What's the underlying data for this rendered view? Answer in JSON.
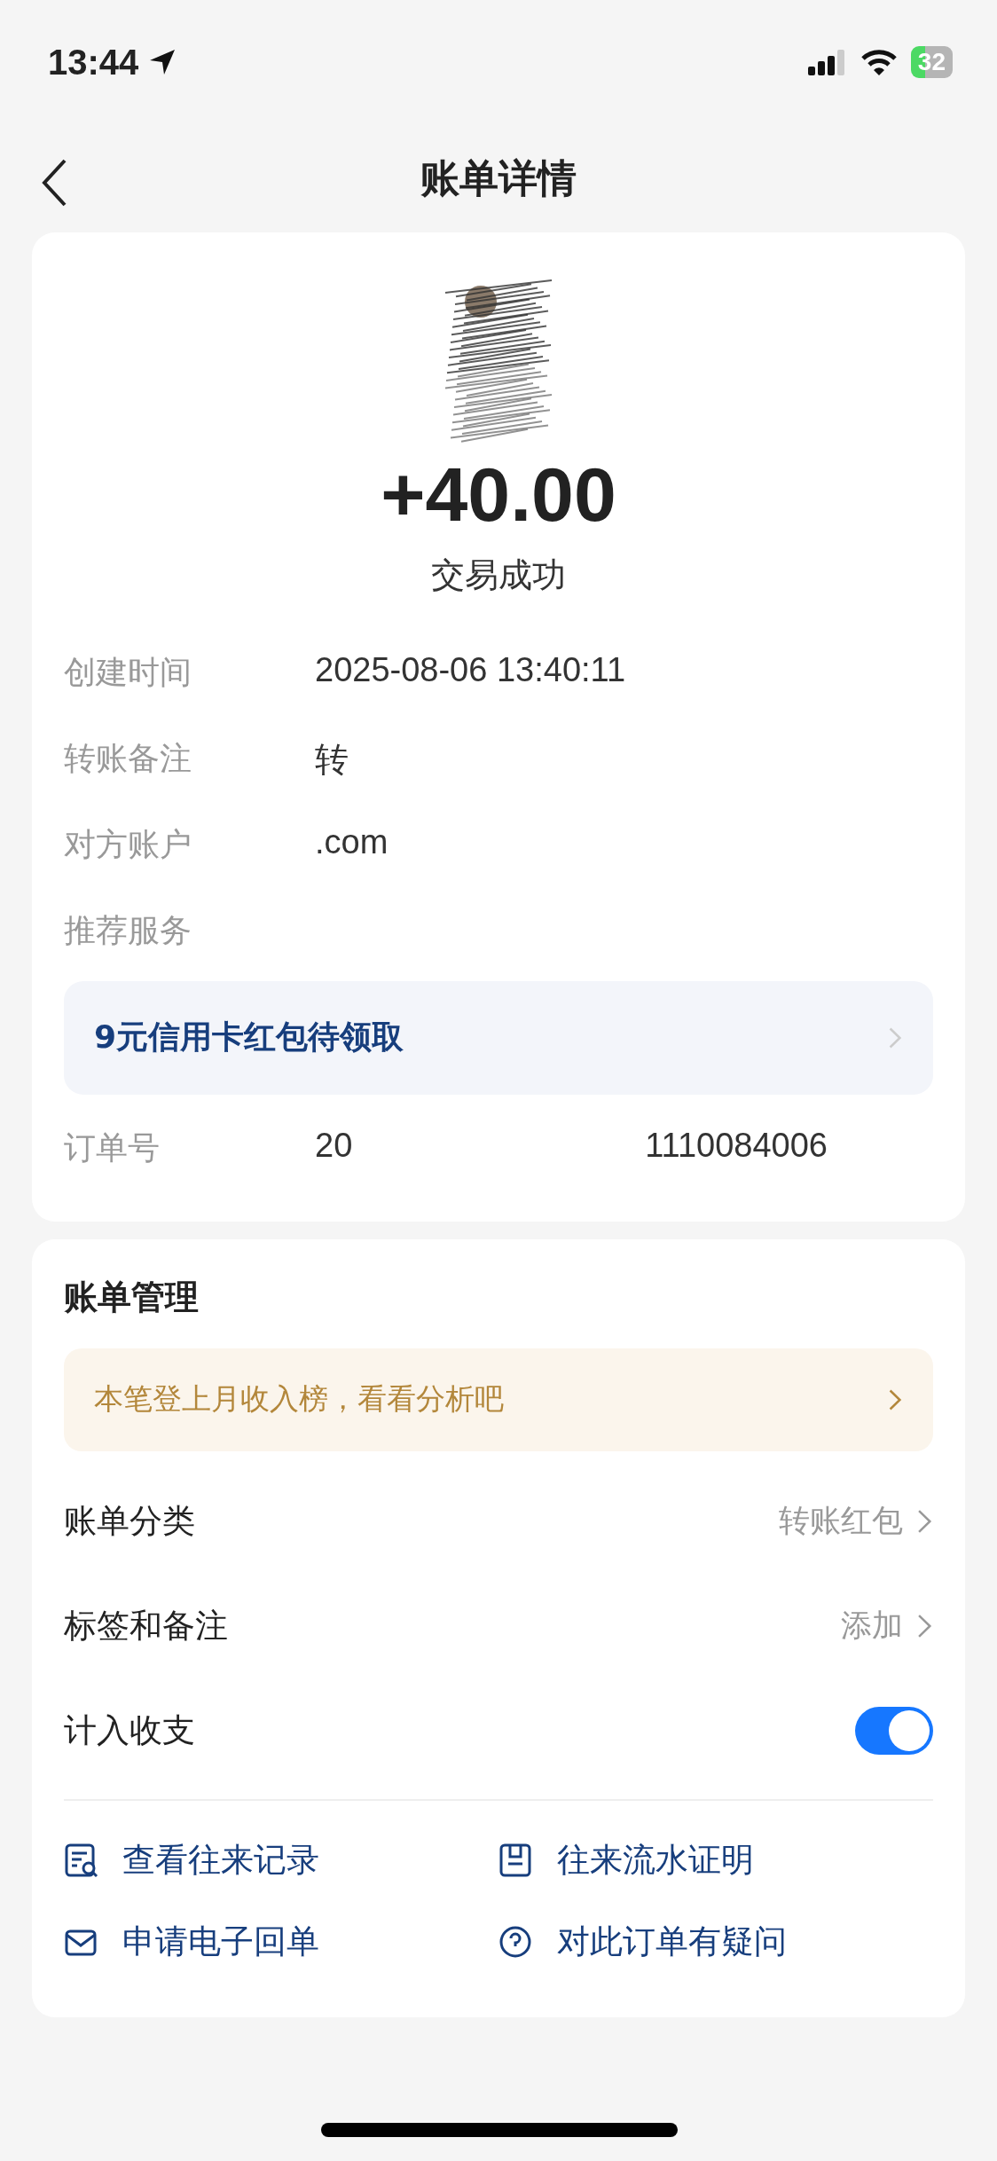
{
  "status_bar": {
    "time": "13:44",
    "battery": "32"
  },
  "nav": {
    "title": "账单详情"
  },
  "summary": {
    "amount": "+40.00",
    "status": "交易成功"
  },
  "details": [
    {
      "kind": "text",
      "label": "创建时间",
      "value": "2025-08-06 13:40:11"
    },
    {
      "kind": "text",
      "label": "转账备注",
      "value": "转"
    },
    {
      "kind": "text",
      "label": "对方账户",
      "value": ".com"
    },
    {
      "kind": "promo",
      "label": "推荐服务",
      "promo": "9元信用卡红包待领取"
    },
    {
      "kind": "text",
      "label": "订单号",
      "value": "20",
      "value_2": "1110084006"
    }
  ],
  "management": {
    "title": "账单管理",
    "banner": "本笔登上月收入榜，看看分析吧",
    "rows": [
      {
        "kind": "link",
        "label": "账单分类",
        "value": "转账红包"
      },
      {
        "kind": "link",
        "label": "标签和备注",
        "value": "添加"
      },
      {
        "kind": "toggle",
        "label": "计入收支",
        "on": true
      }
    ],
    "actions": [
      {
        "kind": "records",
        "label": "查看往来记录"
      },
      {
        "kind": "proof",
        "label": "往来流水证明"
      },
      {
        "kind": "receipt",
        "label": "申请电子回单"
      },
      {
        "kind": "question",
        "label": "对此订单有疑问"
      }
    ]
  }
}
